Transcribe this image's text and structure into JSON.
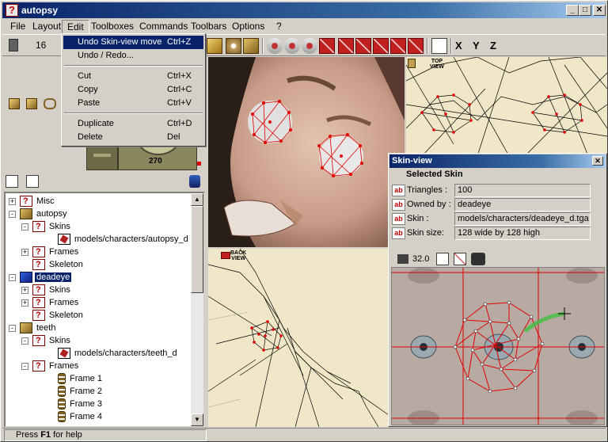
{
  "window": {
    "title": "autopsy",
    "min": "_",
    "max": "□",
    "close": "✕"
  },
  "menubar": [
    "File",
    "Layout",
    "Edit",
    "Toolboxes",
    "Commands",
    "Toolbars",
    "Options",
    "?"
  ],
  "toolbar": {
    "number": "16",
    "axes": [
      "X",
      "Y",
      "Z"
    ]
  },
  "edit_menu": [
    {
      "label": "Undo Skin-view move",
      "accel": "Ctrl+Z"
    },
    {
      "label": "Undo / Redo...",
      "accel": ""
    },
    {
      "label": "Cut",
      "accel": "Ctrl+X"
    },
    {
      "label": "Copy",
      "accel": "Ctrl+C"
    },
    {
      "label": "Paste",
      "accel": "Ctrl+V"
    },
    {
      "label": "Duplicate",
      "accel": "Ctrl+D"
    },
    {
      "label": "Delete",
      "accel": "Del"
    }
  ],
  "compass_value": "270",
  "tree": [
    {
      "label": "Misc"
    },
    {
      "label": "autopsy"
    },
    {
      "label": "Skins"
    },
    {
      "label": "models/characters/autopsy_d"
    },
    {
      "label": "Frames"
    },
    {
      "label": "Skeleton"
    },
    {
      "label": "deadeye"
    },
    {
      "label": "Skins"
    },
    {
      "label": "Frames"
    },
    {
      "label": "Skeleton"
    },
    {
      "label": "teeth"
    },
    {
      "label": "Skins"
    },
    {
      "label": "models/characters/teeth_d"
    },
    {
      "label": "Frames"
    },
    {
      "label": "Frame 1"
    },
    {
      "label": "Frame 2"
    },
    {
      "label": "Frame 3"
    },
    {
      "label": "Frame 4"
    }
  ],
  "status": {
    "prefix": "Press",
    "key": "F1",
    "suffix": "for help"
  },
  "views": {
    "top": [
      "TOP",
      "VIEW"
    ],
    "back": [
      "BACK",
      "VIEW"
    ]
  },
  "skin": {
    "title": "Skin-view",
    "heading": "Selected Skin",
    "rows": [
      {
        "label": "Triangles :",
        "value": "100"
      },
      {
        "label": "Owned by :",
        "value": "deadeye"
      },
      {
        "label": "Skin :",
        "value": "models/characters/deadeye_d.tga"
      },
      {
        "label": "Skin size:",
        "value": "128 wide by 128 high"
      }
    ],
    "ab": "ab",
    "zoom": "32.0"
  }
}
